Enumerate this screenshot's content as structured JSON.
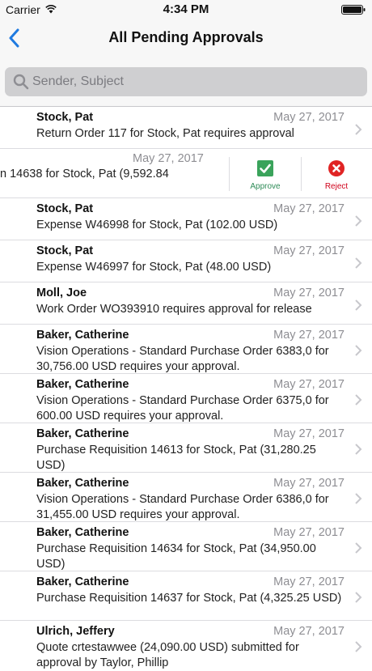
{
  "status_bar": {
    "carrier": "Carrier",
    "time": "4:34 PM"
  },
  "nav": {
    "title": "All Pending Approvals",
    "back_icon": "chevron-left-icon"
  },
  "search": {
    "placeholder": "Sender, Subject",
    "value": ""
  },
  "colors": {
    "accent": "#1f7ae0",
    "approve": "#3aa35b",
    "reject": "#e02424",
    "date": "#8e8e93"
  },
  "approvals": [
    {
      "sender": "Stock, Pat",
      "date": "May 27, 2017",
      "subject": "Return Order 117 for Stock, Pat requires approval"
    }
  ],
  "swiped_item": {
    "date": "May 27, 2017",
    "subject": "n 14638 for Stock, Pat (9,592.84",
    "approve_label": "Approve",
    "reject_label": "Reject"
  },
  "approvals_rest": [
    {
      "sender": "Stock, Pat",
      "date": "May 27, 2017",
      "subject": "Expense W46998 for Stock, Pat (102.00 USD)"
    },
    {
      "sender": "Stock, Pat",
      "date": "May 27, 2017",
      "subject": "Expense W46997 for Stock, Pat (48.00 USD)"
    },
    {
      "sender": "Moll, Joe",
      "date": "May 27, 2017",
      "subject": "Work Order WO393910 requires approval for release"
    },
    {
      "sender": "Baker, Catherine",
      "date": "May 27, 2017",
      "subject": "Vision Operations - Standard Purchase Order 6383,0 for 30,756.00 USD requires your approval."
    },
    {
      "sender": "Baker, Catherine",
      "date": "May 27, 2017",
      "subject": "Vision Operations - Standard Purchase Order 6375,0 for 600.00 USD requires your approval."
    },
    {
      "sender": "Baker, Catherine",
      "date": "May 27, 2017",
      "subject": "Purchase Requisition 14613 for Stock, Pat (31,280.25 USD)"
    },
    {
      "sender": "Baker, Catherine",
      "date": "May 27, 2017",
      "subject": "Vision Operations - Standard Purchase Order 6386,0 for 31,455.00 USD requires your approval."
    },
    {
      "sender": "Baker, Catherine",
      "date": "May 27, 2017",
      "subject": "Purchase Requisition 14634 for Stock, Pat (34,950.00 USD)"
    },
    {
      "sender": "Baker, Catherine",
      "date": "May 27, 2017",
      "subject": "Purchase Requisition 14637 for Stock, Pat (4,325.25 USD)"
    },
    {
      "sender": "Ulrich, Jeffery",
      "date": "May 27, 2017",
      "subject": "Quote crtestawwee (24,090.00 USD) submitted for approval by Taylor, Phillip"
    }
  ]
}
